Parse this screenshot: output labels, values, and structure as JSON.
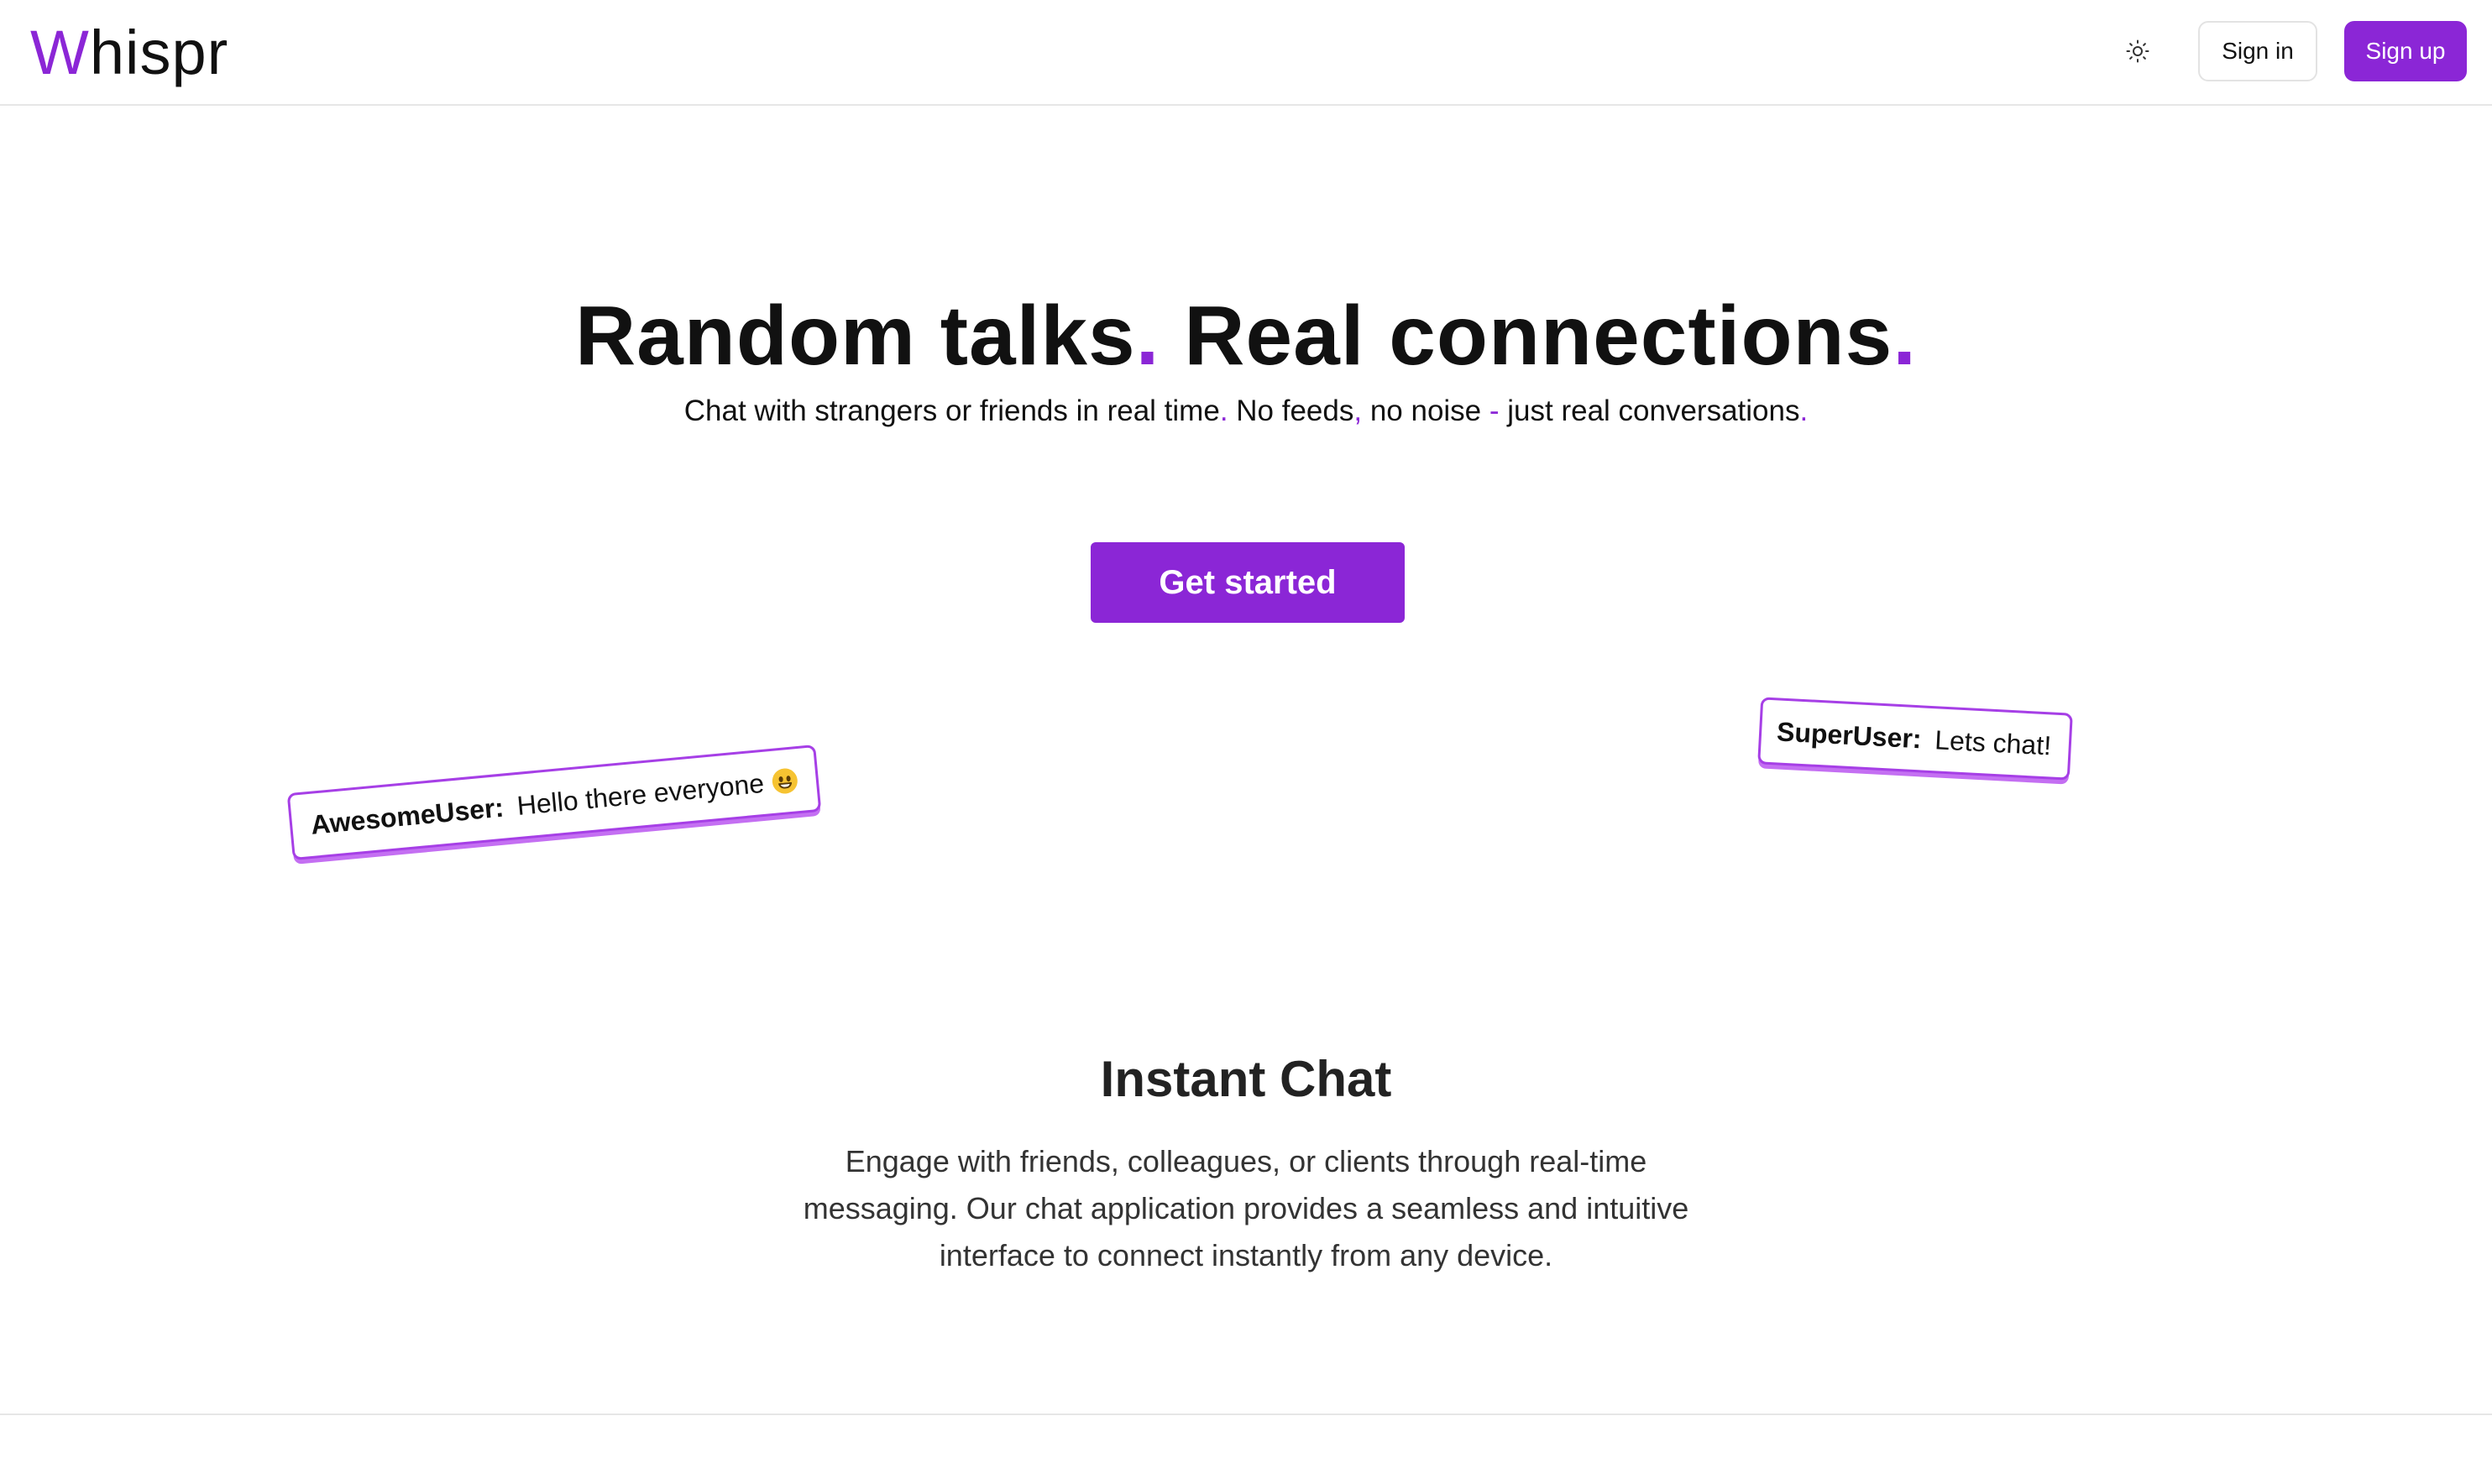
{
  "header": {
    "logo_first": "W",
    "logo_rest": "hispr",
    "theme_toggle_icon": "sun-icon",
    "signin_label": "Sign in",
    "signup_label": "Sign up"
  },
  "hero": {
    "title_part1": "Random talks",
    "title_dot1": ".",
    "title_part2": " Real connections",
    "title_dot2": ".",
    "sub_part1": "Chat with strangers or friends in real time",
    "sub_dot1": ".",
    "sub_part2": " No feeds",
    "sub_comma": ",",
    "sub_part3": " no noise ",
    "sub_dash": "-",
    "sub_part4": " just real conversations",
    "sub_dot2": ".",
    "cta_label": "Get started"
  },
  "bubbles": [
    {
      "user": "AwesomeUser:",
      "message": "Hello there everyone",
      "emoji": "grinning-face-emoji"
    },
    {
      "user": "SuperUser:",
      "message": "Lets chat!"
    }
  ],
  "feature": {
    "title": "Instant Chat",
    "body": "Engage with friends, colleagues, or clients through real-time messaging. Our chat application provides a seamless and intuitive interface to connect instantly from any device."
  },
  "colors": {
    "accent": "#8b26d6",
    "bubble_border": "#a63fe6"
  }
}
